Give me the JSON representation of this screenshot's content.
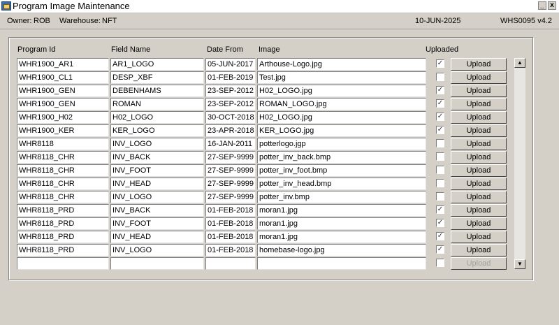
{
  "window": {
    "title": "Program Image Maintenance",
    "minimize": "_",
    "close": "x"
  },
  "info": {
    "owner_label": "Owner:",
    "owner": "ROB",
    "warehouse_label": "Warehouse:",
    "warehouse": "NFT",
    "date": "10-JUN-2025",
    "module": "WHS0095  v4.2"
  },
  "columns": {
    "program_id": "Program Id",
    "field_name": "Field Name",
    "date_from": "Date From",
    "image": "Image",
    "uploaded": "Uploaded"
  },
  "upload_label": "Upload",
  "rows": [
    {
      "program_id": "WHR1900_AR1",
      "field_name": "AR1_LOGO",
      "date_from": "05-JUN-2017",
      "image": "Arthouse-Logo.jpg",
      "uploaded": "✓"
    },
    {
      "program_id": "WHR1900_CL1",
      "field_name": "DESP_XBF",
      "date_from": "01-FEB-2019",
      "image": "Test.jpg",
      "uploaded": ""
    },
    {
      "program_id": "WHR1900_GEN",
      "field_name": "DEBENHAMS",
      "date_from": "23-SEP-2012",
      "image": "H02_LOGO.jpg",
      "uploaded": "✓"
    },
    {
      "program_id": "WHR1900_GEN",
      "field_name": "ROMAN",
      "date_from": "23-SEP-2012",
      "image": "ROMAN_LOGO.jpg",
      "uploaded": "✓"
    },
    {
      "program_id": "WHR1900_H02",
      "field_name": "H02_LOGO",
      "date_from": "30-OCT-2018",
      "image": "H02_LOGO.jpg",
      "uploaded": "✓"
    },
    {
      "program_id": "WHR1900_KER",
      "field_name": "KER_LOGO",
      "date_from": "23-APR-2018",
      "image": "KER_LOGO.jpg",
      "uploaded": "✓"
    },
    {
      "program_id": "WHR8118",
      "field_name": "INV_LOGO",
      "date_from": "16-JAN-2011",
      "image": "potterlogo.jgp",
      "uploaded": ""
    },
    {
      "program_id": "WHR8118_CHR",
      "field_name": "INV_BACK",
      "date_from": "27-SEP-9999",
      "image": "potter_inv_back.bmp",
      "uploaded": ""
    },
    {
      "program_id": "WHR8118_CHR",
      "field_name": "INV_FOOT",
      "date_from": "27-SEP-9999",
      "image": "potter_inv_foot.bmp",
      "uploaded": ""
    },
    {
      "program_id": "WHR8118_CHR",
      "field_name": "INV_HEAD",
      "date_from": "27-SEP-9999",
      "image": "potter_inv_head.bmp",
      "uploaded": ""
    },
    {
      "program_id": "WHR8118_CHR",
      "field_name": "INV_LOGO",
      "date_from": "27-SEP-9999",
      "image": "potter_inv.bmp",
      "uploaded": ""
    },
    {
      "program_id": "WHR8118_PRD",
      "field_name": "INV_BACK",
      "date_from": "01-FEB-2018",
      "image": "moran1.jpg",
      "uploaded": "✓"
    },
    {
      "program_id": "WHR8118_PRD",
      "field_name": "INV_FOOT",
      "date_from": "01-FEB-2018",
      "image": "moran1.jpg",
      "uploaded": "✓"
    },
    {
      "program_id": "WHR8118_PRD",
      "field_name": "INV_HEAD",
      "date_from": "01-FEB-2018",
      "image": "moran1.jpg",
      "uploaded": "✓"
    },
    {
      "program_id": "WHR8118_PRD",
      "field_name": "INV_LOGO",
      "date_from": "01-FEB-2018",
      "image": "homebase-logo.jpg",
      "uploaded": "✓"
    },
    {
      "program_id": "",
      "field_name": "",
      "date_from": "",
      "image": "",
      "uploaded": ""
    }
  ],
  "scroll": {
    "up": "▲",
    "down": "▼"
  }
}
